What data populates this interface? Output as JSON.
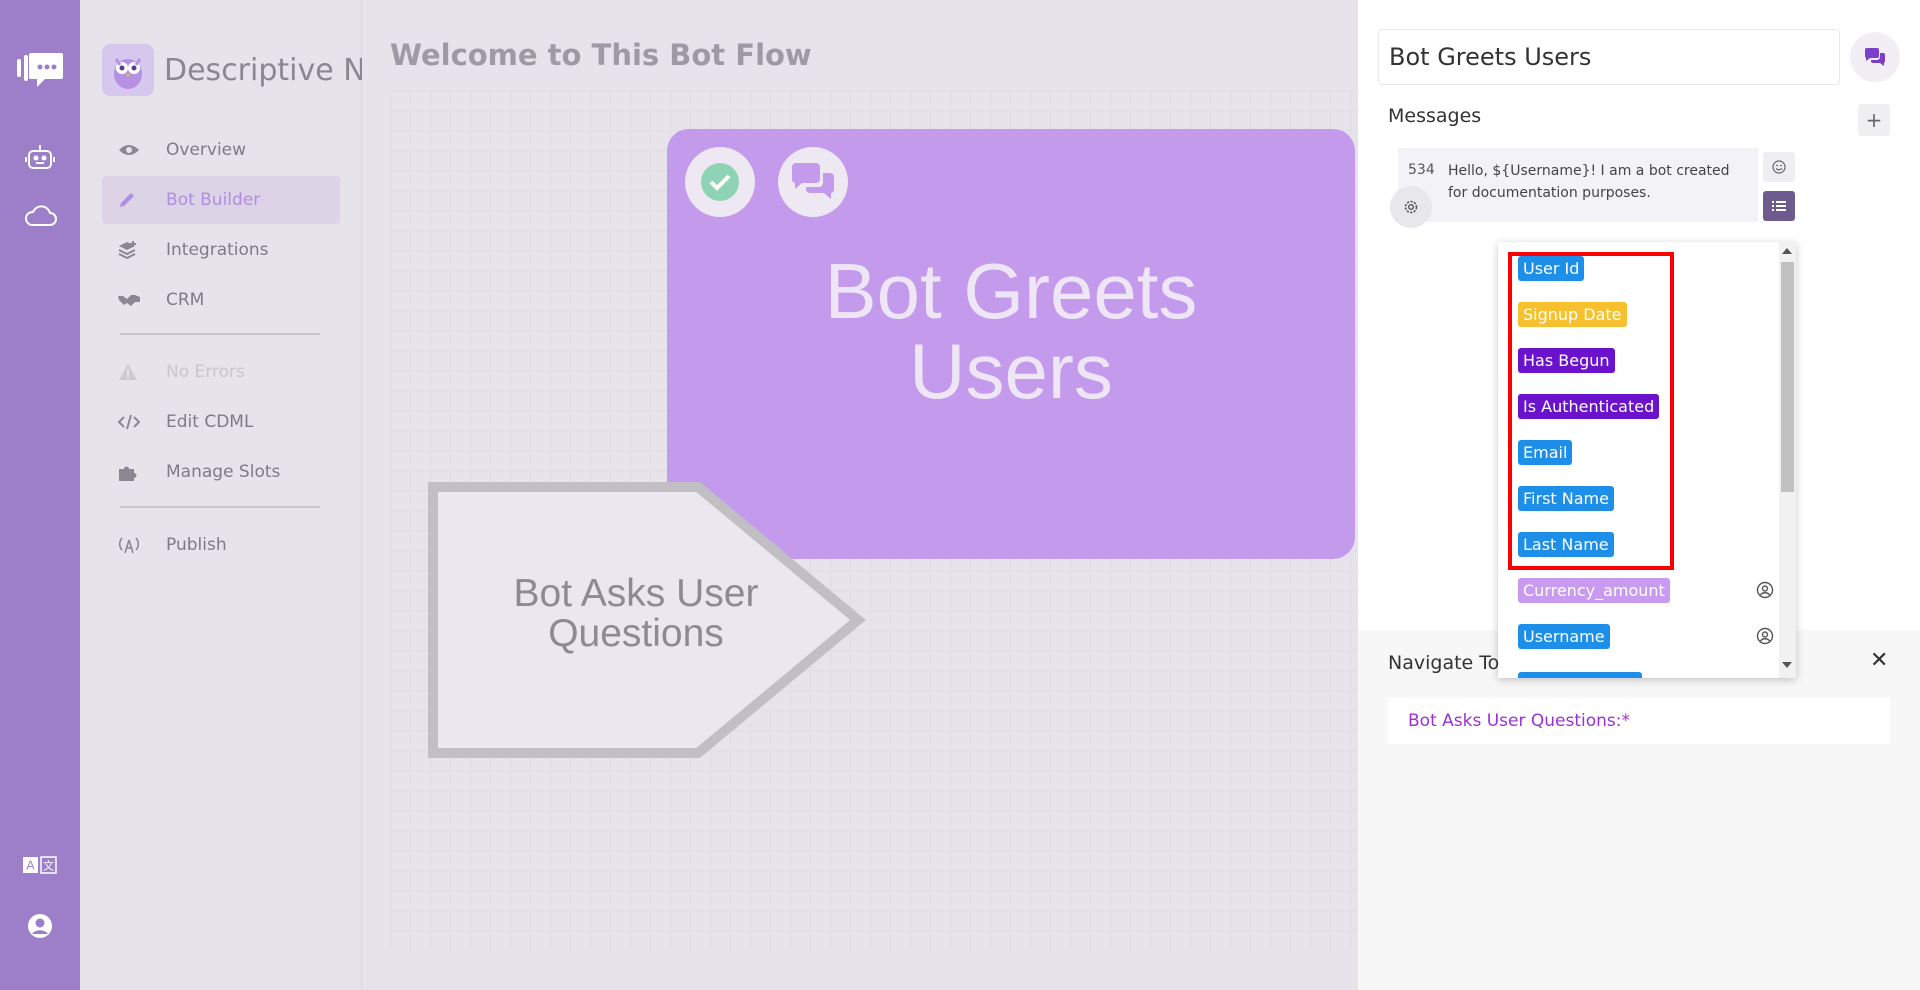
{
  "rail": {
    "icons": [
      "chat-logo-icon",
      "robot-icon",
      "cloud-icon",
      "translate-icon",
      "user-account-icon"
    ]
  },
  "sidebar": {
    "brand_name": "Descriptive N",
    "items": [
      {
        "label": "Overview",
        "icon": "eye-icon"
      },
      {
        "label": "Bot Builder",
        "icon": "pencil-icon"
      },
      {
        "label": "Integrations",
        "icon": "layers-plus-icon"
      },
      {
        "label": "CRM",
        "icon": "handshake-icon"
      },
      {
        "label": "No Errors",
        "icon": "warning-icon"
      },
      {
        "label": "Edit CDML",
        "icon": "code-icon"
      },
      {
        "label": "Manage Slots",
        "icon": "puzzle-icon"
      },
      {
        "label": "Publish",
        "icon": "broadcast-icon"
      }
    ]
  },
  "canvas": {
    "title": "Welcome to This Bot Flow",
    "node_main": {
      "title_line1": "Bot Greets",
      "title_line2": "Users"
    },
    "node_secondary": {
      "title_line1": "Bot Asks User",
      "title_line2": "Questions"
    }
  },
  "panel": {
    "title": "Bot Greets Users",
    "messages_label": "Messages",
    "add_label": "+",
    "message": {
      "number": "534",
      "text": "Hello, ${Username}! I am a bot created for documentation purposes."
    },
    "slots": [
      {
        "label": "User Id",
        "color": "#1d8fe8"
      },
      {
        "label": "Signup Date",
        "color": "#f6c02f"
      },
      {
        "label": "Has Begun",
        "color": "#6b13cc"
      },
      {
        "label": "Is Authenticated",
        "color": "#6b13cc"
      },
      {
        "label": "Email",
        "color": "#1d8fe8"
      },
      {
        "label": "First Name",
        "color": "#1d8fe8"
      },
      {
        "label": "Last Name",
        "color": "#1d8fe8"
      },
      {
        "label": "Currency_amount",
        "color": "#c99bf0"
      },
      {
        "label": "Username",
        "color": "#1d8fe8"
      },
      {
        "label": "",
        "color": "#1d8fe8"
      }
    ],
    "navigate_label": "Navigate To",
    "close_label": "✕",
    "navigate_link": "Bot Asks User Questions:*"
  }
}
